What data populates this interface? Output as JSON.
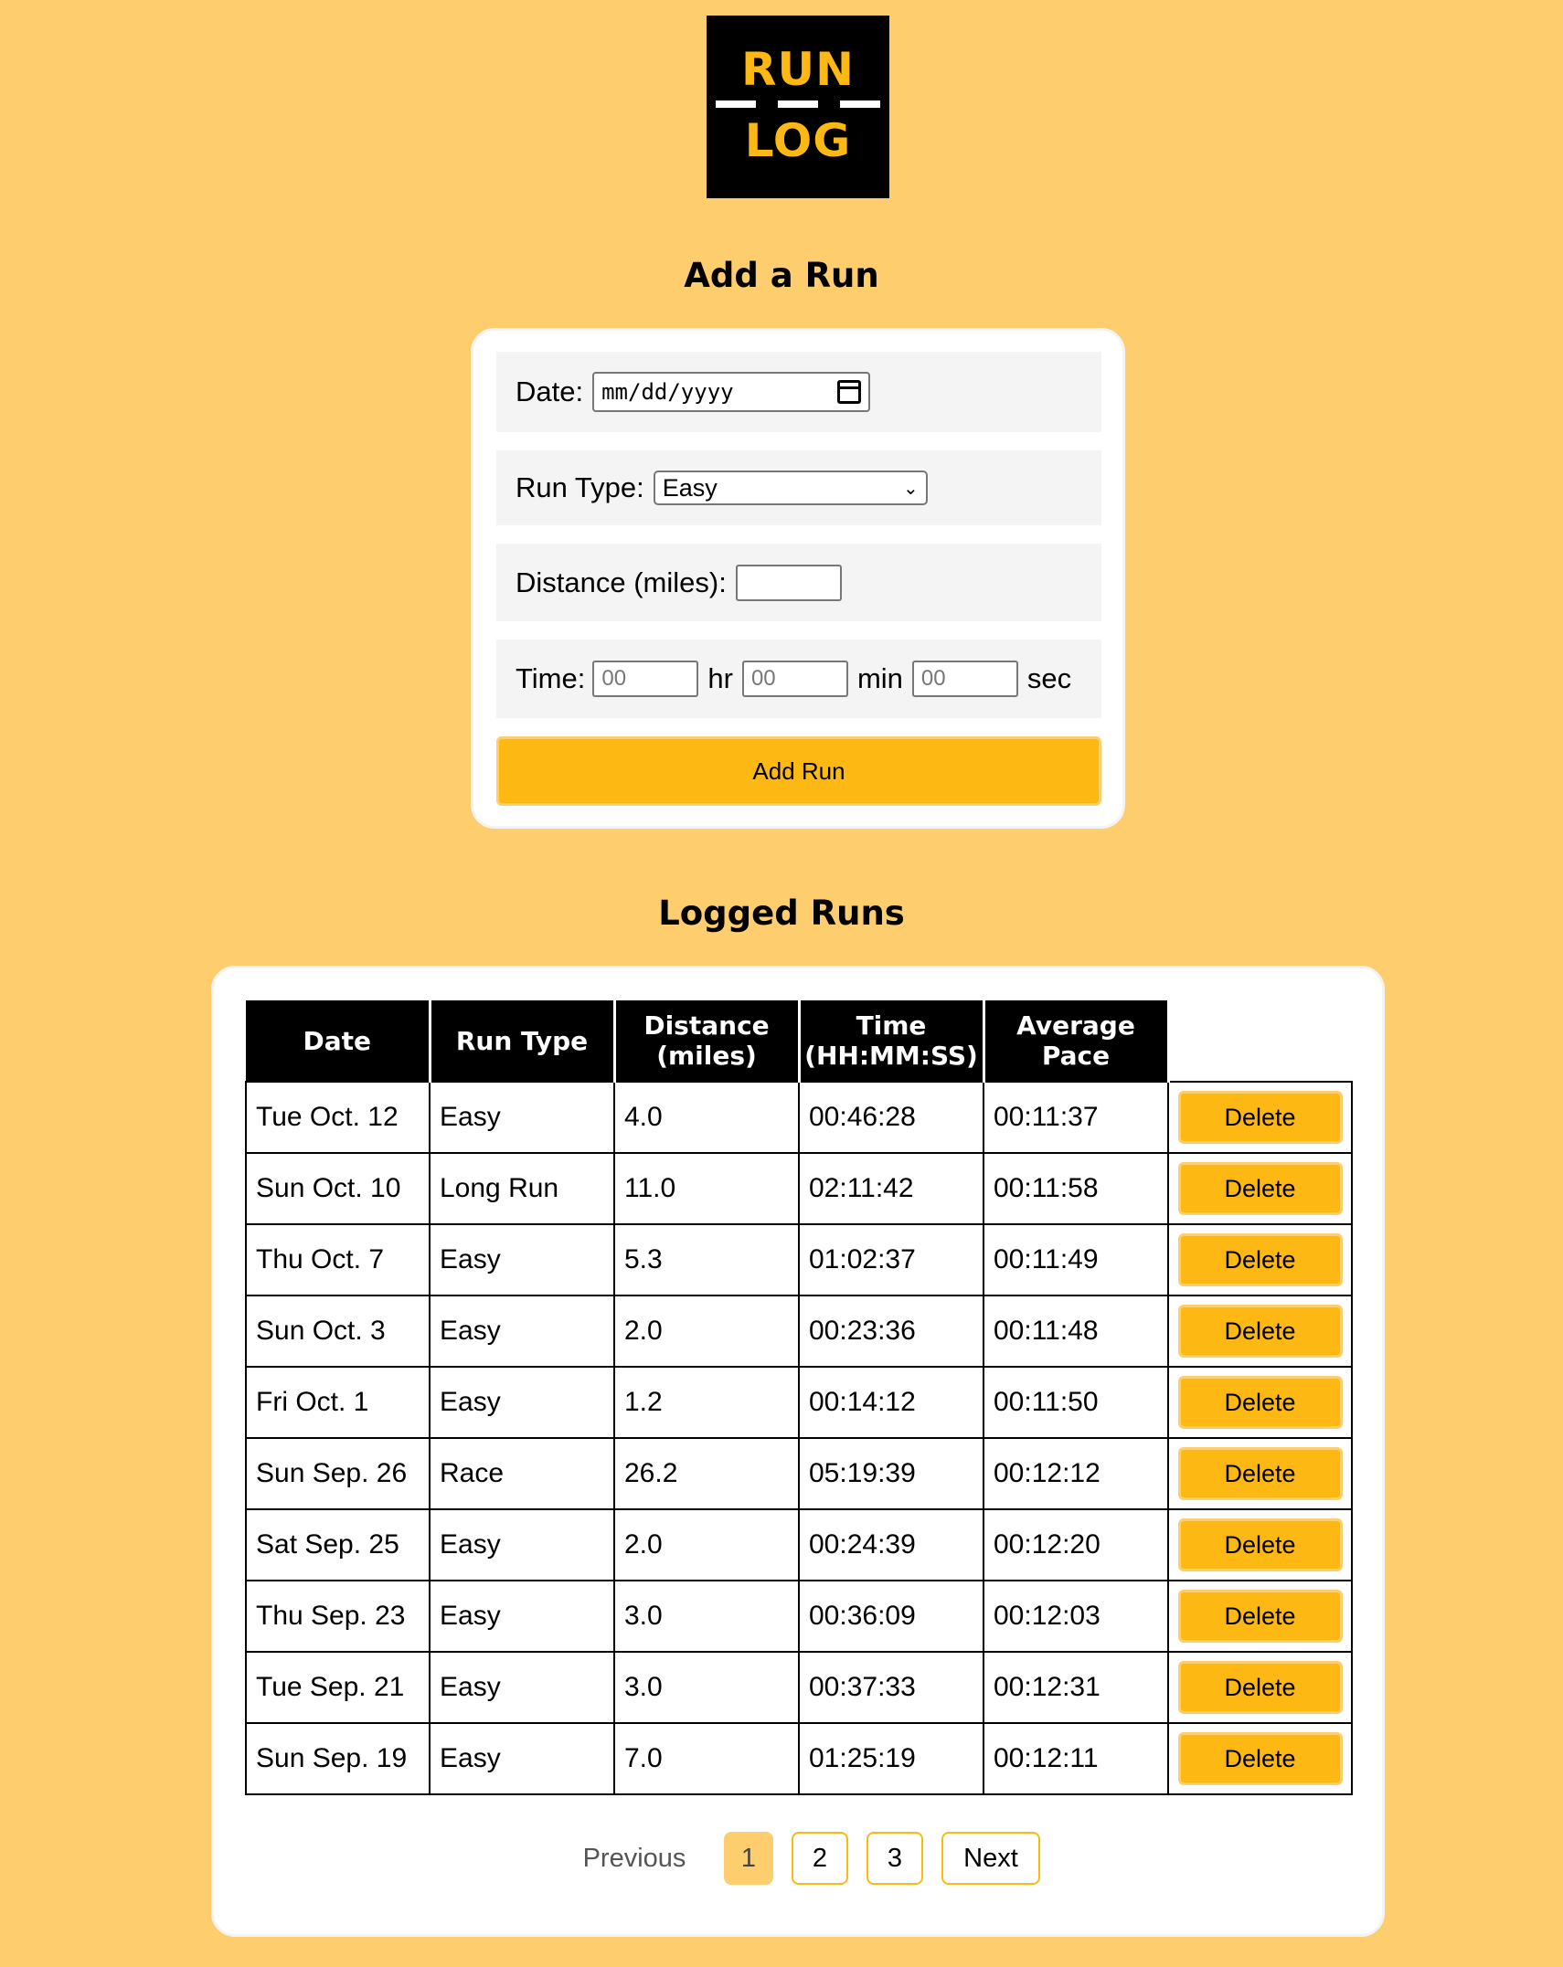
{
  "logo": {
    "line1": "RUN",
    "line2": "LOG"
  },
  "form": {
    "title": "Add a Run",
    "date_label": "Date:",
    "date_placeholder": "mm/dd/yyyy",
    "run_type_label": "Run Type:",
    "run_type_value": "Easy",
    "distance_label": "Distance (miles):",
    "distance_value": "",
    "time_label": "Time:",
    "hours_placeholder": "00",
    "hours_unit": "hr",
    "minutes_placeholder": "00",
    "minutes_unit": "min",
    "seconds_placeholder": "00",
    "seconds_unit": "sec",
    "submit_label": "Add Run"
  },
  "log": {
    "title": "Logged Runs",
    "headers": {
      "date": "Date",
      "run_type": "Run Type",
      "distance_l1": "Distance",
      "distance_l2": "(miles)",
      "time_l1": "Time",
      "time_l2": "(HH:MM:SS)",
      "pace_l1": "Average",
      "pace_l2": "Pace"
    },
    "delete_label": "Delete",
    "rows": [
      {
        "date": "Tue Oct. 12",
        "type": "Easy",
        "distance": "4.0",
        "time": "00:46:28",
        "pace": "00:11:37"
      },
      {
        "date": "Sun Oct. 10",
        "type": "Long Run",
        "distance": "11.0",
        "time": "02:11:42",
        "pace": "00:11:58"
      },
      {
        "date": "Thu Oct. 7",
        "type": "Easy",
        "distance": "5.3",
        "time": "01:02:37",
        "pace": "00:11:49"
      },
      {
        "date": "Sun Oct. 3",
        "type": "Easy",
        "distance": "2.0",
        "time": "00:23:36",
        "pace": "00:11:48"
      },
      {
        "date": "Fri Oct. 1",
        "type": "Easy",
        "distance": "1.2",
        "time": "00:14:12",
        "pace": "00:11:50"
      },
      {
        "date": "Sun Sep. 26",
        "type": "Race",
        "distance": "26.2",
        "time": "05:19:39",
        "pace": "00:12:12"
      },
      {
        "date": "Sat Sep. 25",
        "type": "Easy",
        "distance": "2.0",
        "time": "00:24:39",
        "pace": "00:12:20"
      },
      {
        "date": "Thu Sep. 23",
        "type": "Easy",
        "distance": "3.0",
        "time": "00:36:09",
        "pace": "00:12:03"
      },
      {
        "date": "Tue Sep. 21",
        "type": "Easy",
        "distance": "3.0",
        "time": "00:37:33",
        "pace": "00:12:31"
      },
      {
        "date": "Sun Sep. 19",
        "type": "Easy",
        "distance": "7.0",
        "time": "01:25:19",
        "pace": "00:12:11"
      }
    ]
  },
  "pagination": {
    "previous_label": "Previous",
    "pages": [
      "1",
      "2",
      "3"
    ],
    "current_page": "1",
    "next_label": "Next"
  },
  "colors": {
    "background": "#FECD6D",
    "accent": "#FDB813",
    "header": "#000000"
  }
}
